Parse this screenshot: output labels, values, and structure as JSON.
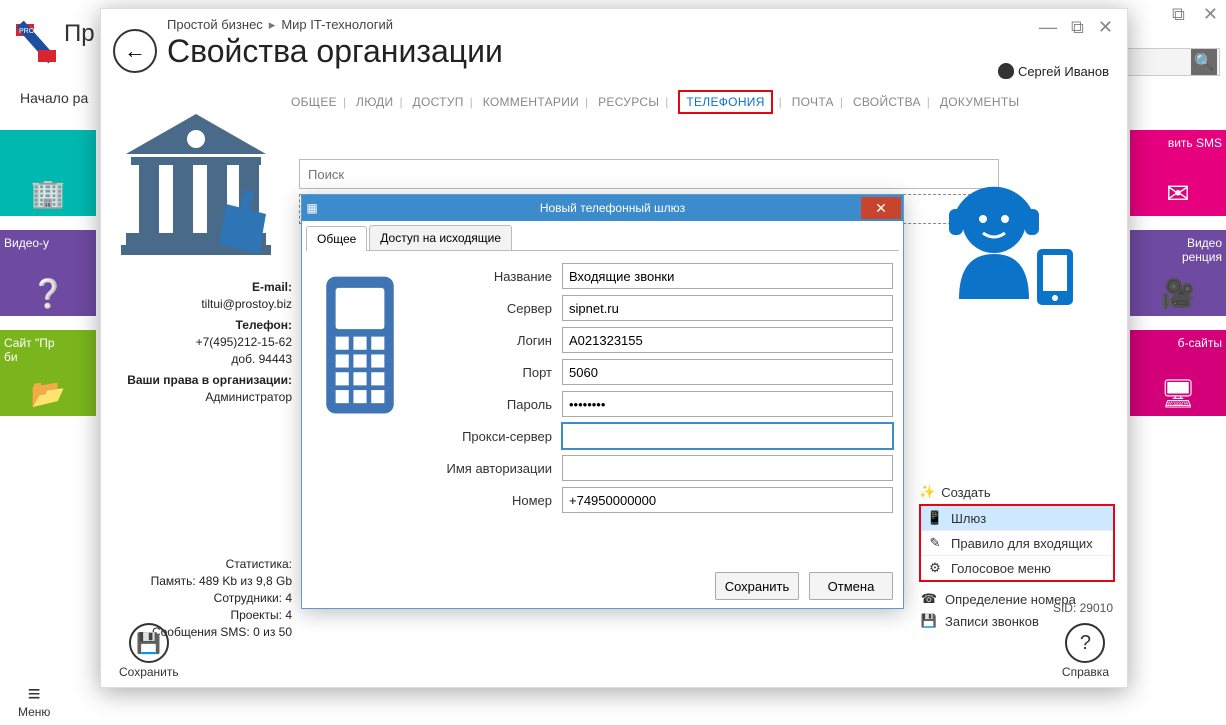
{
  "bg": {
    "start_label": "Начало ра",
    "tiles_left": [
      {
        "label": "",
        "color": "c-teal"
      },
      {
        "label": "Видео-у",
        "color": "c-purple"
      },
      {
        "label": "Сайт \"Пр\nби",
        "color": "c-green"
      }
    ],
    "tiles_right": [
      {
        "label": "вить SMS",
        "color": "c-pink"
      },
      {
        "label": "Видео\nренция",
        "color": "c-purple"
      },
      {
        "label": "б-сайты",
        "color": "c-magenta"
      }
    ],
    "menu_label": "Меню",
    "truncated_title": "Пр\nС"
  },
  "modal": {
    "breadcrumb": {
      "a": "Простой бизнес",
      "b": "Мир IT-технологий"
    },
    "title": "Свойства организации",
    "user": "Сергей Иванов",
    "tabs": [
      "ОБЩЕЕ",
      "ЛЮДИ",
      "ДОСТУП",
      "КОММЕНТАРИИ",
      "РЕСУРСЫ",
      "ТЕЛЕФОНИЯ",
      "ПОЧТА",
      "СВОЙСТВА",
      "ДОКУМЕНТЫ"
    ],
    "active_tab_index": 5,
    "search_placeholder": "Поиск",
    "info": {
      "email_label": "E-mail:",
      "email_value": "tiltui@prostoy.biz",
      "phone_label": "Телефон:",
      "phone_value": "+7(495)212-15-62",
      "phone_ext": "доб. 94443",
      "rights_label": "Ваши права в организации:",
      "rights_value": "Администратор"
    },
    "stats": {
      "label": "Статистика:",
      "memory": "Память: 489 Kb из 9,8 Gb",
      "employees": "Сотрудники: 4",
      "projects": "Проекты: 4",
      "sms": "Сообщения SMS: 0 из 50"
    },
    "right": {
      "create_label": "Создать",
      "menu": [
        {
          "label": "Шлюз",
          "icon": "📱"
        },
        {
          "label": "Правило для входящих",
          "icon": "✎"
        },
        {
          "label": "Голосовое меню",
          "icon": "⚙"
        }
      ],
      "links": [
        {
          "label": "Определение номера",
          "icon": "☎"
        },
        {
          "label": "Записи звонков",
          "icon": "💾"
        }
      ]
    },
    "sid": "SID: 29010",
    "footer": {
      "save": "Сохранить",
      "help": "Справка"
    }
  },
  "dialog": {
    "title": "Новый телефонный шлюз",
    "tabs": {
      "general": "Общее",
      "outgoing": "Доступ на исходящие"
    },
    "fields": {
      "name": {
        "label": "Название",
        "value": "Входящие звонки"
      },
      "server": {
        "label": "Сервер",
        "value": "sipnet.ru"
      },
      "login": {
        "label": "Логин",
        "value": "A021323155"
      },
      "port": {
        "label": "Порт",
        "value": "5060"
      },
      "password": {
        "label": "Пароль",
        "value": "••••••••"
      },
      "proxy": {
        "label": "Прокси-сервер",
        "value": ""
      },
      "auth": {
        "label": "Имя авторизации",
        "value": ""
      },
      "number": {
        "label": "Номер",
        "value": "+74950000000"
      }
    },
    "buttons": {
      "save": "Сохранить",
      "cancel": "Отмена"
    }
  }
}
